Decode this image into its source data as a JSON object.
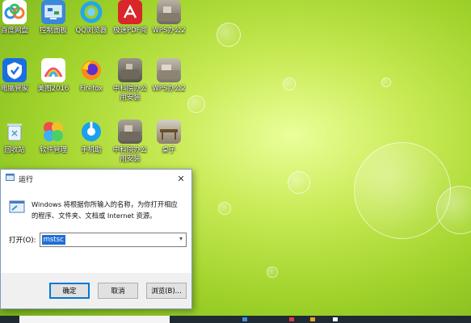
{
  "desktop": {
    "icons": [
      {
        "label": "百度网盘",
        "icon": "baidu-netdisk-icon"
      },
      {
        "label": "控制面板",
        "icon": "control-panel-icon"
      },
      {
        "label": "QQ浏览器",
        "icon": "qq-browser-icon"
      },
      {
        "label": "极速PDF阅",
        "icon": "pdf-reader-icon"
      },
      {
        "label": "WPS办公2",
        "icon": "photo-file-icon"
      },
      {
        "label": "电脑管家",
        "icon": "pc-manager-icon"
      },
      {
        "label": "美图2016",
        "icon": "meitu-icon"
      },
      {
        "label": "Firefox",
        "icon": "firefox-icon"
      },
      {
        "label": "中科院办公用安装",
        "icon": "photo-file-icon"
      },
      {
        "label": "WPS办公2",
        "icon": "photo-file-icon"
      },
      {
        "label": "回收站",
        "icon": "recycle-bin-icon"
      },
      {
        "label": "软件管理",
        "icon": "software-manager-icon"
      },
      {
        "label": "手机助",
        "icon": "phone-assistant-icon"
      },
      {
        "label": "中科院办公用安装",
        "icon": "photo-file-icon"
      },
      {
        "label": "桌子",
        "icon": "photo-file-icon"
      }
    ]
  },
  "run_dialog": {
    "title": "运行",
    "description": "Windows 将根据你所输入的名称，为你打开相应的程序、文件夹、文档或 Internet 资源。",
    "open_label": "打开(O):",
    "input_value": "mstsc",
    "ok_label": "确定",
    "cancel_label": "取消",
    "browse_label": "浏览(B)...",
    "close_glyph": "✕"
  },
  "colors": {
    "accent": "#0078d7",
    "selection": "#1f6fd6",
    "wallpaper_light": "#eaff9a",
    "wallpaper_dark": "#76b01a"
  }
}
